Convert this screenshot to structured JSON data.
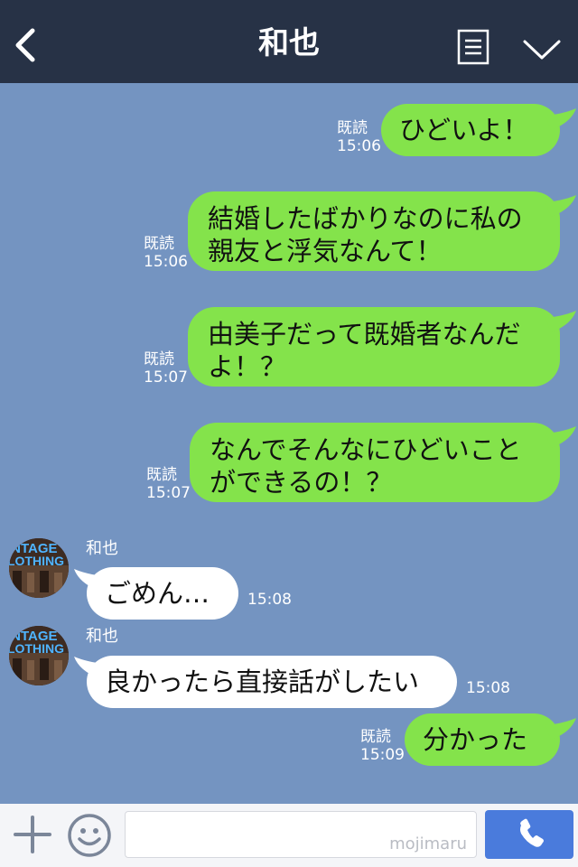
{
  "header": {
    "title": "和也"
  },
  "messages": [
    {
      "side": "me",
      "read_label": "既読",
      "time": "15:06",
      "lines": [
        "ひどいよ！"
      ]
    },
    {
      "side": "me",
      "read_label": "既読",
      "time": "15:06",
      "lines": [
        "結婚したばかりなのに私の",
        "親友と浮気なんて！"
      ]
    },
    {
      "side": "me",
      "read_label": "既読",
      "time": "15:07",
      "lines": [
        "由美子だって既婚者なんだ",
        "よ！？"
      ]
    },
    {
      "side": "me",
      "read_label": "既読",
      "time": "15:07",
      "lines": [
        "なんでそんなにひどいこと",
        "ができるの！？"
      ]
    },
    {
      "side": "them",
      "sender": "和也",
      "time": "15:08",
      "lines": [
        "ごめん…"
      ],
      "avatar_text": [
        "INTAGE",
        "LOTHING"
      ]
    },
    {
      "side": "them",
      "sender": "和也",
      "time": "15:08",
      "lines": [
        "良かったら直接話がしたい"
      ],
      "avatar_text": [
        "INTAGE",
        "LOTHING"
      ]
    },
    {
      "side": "me",
      "read_label": "既読",
      "time": "15:09",
      "lines": [
        "分かった"
      ]
    }
  ],
  "footer": {
    "watermark": "mojimaru"
  },
  "colors": {
    "header_bg": "#273246",
    "chat_bg": "#7494c1",
    "my_bubble": "#84e34b",
    "their_bubble": "#ffffff",
    "send_button": "#4a7bdc"
  },
  "icons": {
    "back": "back-icon",
    "notes": "notes-icon",
    "menu": "chevron-down-icon",
    "plus": "plus-icon",
    "emoji": "emoji-icon",
    "call": "phone-icon"
  }
}
